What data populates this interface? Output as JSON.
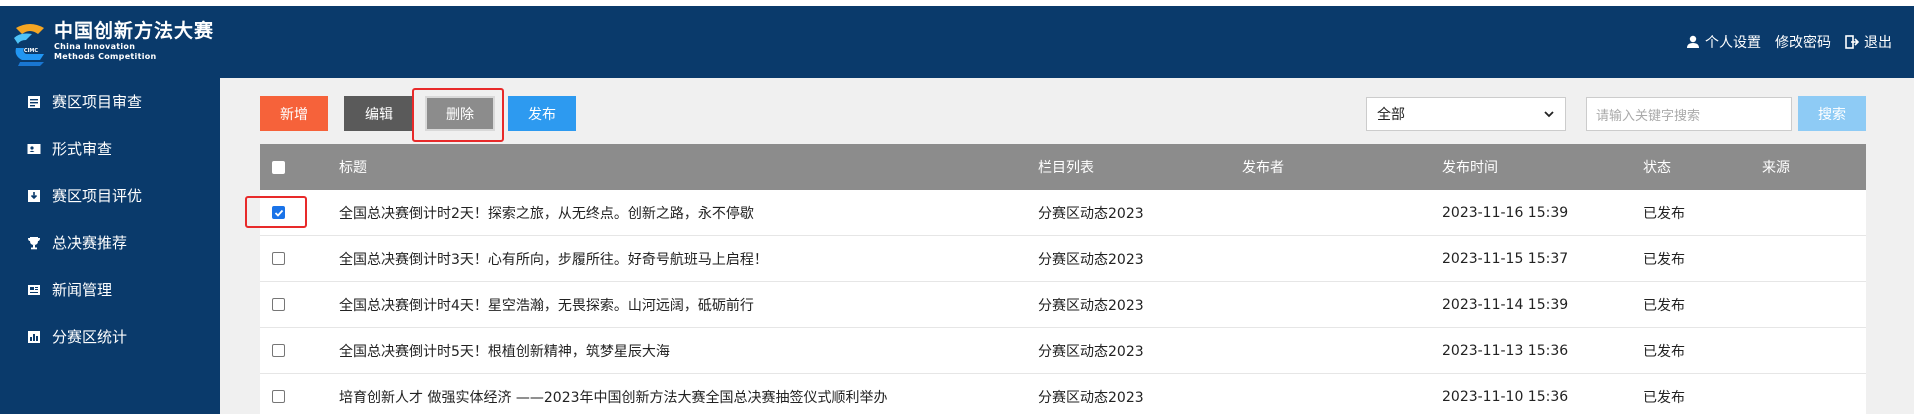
{
  "header": {
    "brand_cn": "中国创新方法大赛",
    "brand_en_line1": "China Innovation",
    "brand_en_line2": "Methods Competition",
    "logo_text": "CIMC",
    "links": [
      {
        "label": "个人设置",
        "icon": "user-icon"
      },
      {
        "label": "修改密码",
        "icon": ""
      },
      {
        "label": "退出",
        "icon": "logout-icon"
      }
    ]
  },
  "sidebar": {
    "items": [
      {
        "label": "赛区项目审查",
        "icon": "document-icon"
      },
      {
        "label": "形式审查",
        "icon": "id-card-icon"
      },
      {
        "label": "赛区项目评优",
        "icon": "download-box-icon"
      },
      {
        "label": "总决赛推荐",
        "icon": "trophy-icon"
      },
      {
        "label": "新闻管理",
        "icon": "news-icon"
      },
      {
        "label": "分赛区统计",
        "icon": "chart-icon"
      }
    ]
  },
  "toolbar": {
    "add_label": "新增",
    "edit_label": "编辑",
    "delete_label": "删除",
    "publish_label": "发布",
    "filter_value": "全部",
    "search_placeholder": "请输入关键字搜索",
    "search_label": "搜索"
  },
  "table": {
    "headers": {
      "title": "标题",
      "category": "栏目列表",
      "author": "发布者",
      "time": "发布时间",
      "status": "状态",
      "source": "来源"
    },
    "rows": [
      {
        "checked": true,
        "title": "全国总决赛倒计时2天！探索之旅，从无终点。创新之路，永不停歇",
        "category": "分赛区动态2023",
        "author": "",
        "time": "2023-11-16 15:39",
        "status": "已发布",
        "source": ""
      },
      {
        "checked": false,
        "title": "全国总决赛倒计时3天！心有所向，步履所往。好奇号航班马上启程！",
        "category": "分赛区动态2023",
        "author": "",
        "time": "2023-11-15 15:37",
        "status": "已发布",
        "source": ""
      },
      {
        "checked": false,
        "title": "全国总决赛倒计时4天！星空浩瀚，无畏探索。山河远阔，砥砺前行",
        "category": "分赛区动态2023",
        "author": "",
        "time": "2023-11-14 15:39",
        "status": "已发布",
        "source": ""
      },
      {
        "checked": false,
        "title": "全国总决赛倒计时5天！根植创新精神，筑梦星辰大海",
        "category": "分赛区动态2023",
        "author": "",
        "time": "2023-11-13 15:36",
        "status": "已发布",
        "source": ""
      },
      {
        "checked": false,
        "title": "培育创新人才 做强实体经济 ——2023年中国创新方法大赛全国总决赛抽签仪式顺利举办",
        "category": "分赛区动态2023",
        "author": "",
        "time": "2023-11-10 15:36",
        "status": "已发布",
        "source": ""
      }
    ]
  },
  "colors": {
    "nav_bg": "#0a3a6b",
    "add_btn": "#f6623a",
    "edit_btn": "#5a5a5a",
    "delete_btn": "#8c8c8c",
    "publish_btn": "#2d9af0",
    "search_btn": "#8ecbf5",
    "table_header": "#8c8c8c",
    "highlight": "#e82a2a"
  }
}
